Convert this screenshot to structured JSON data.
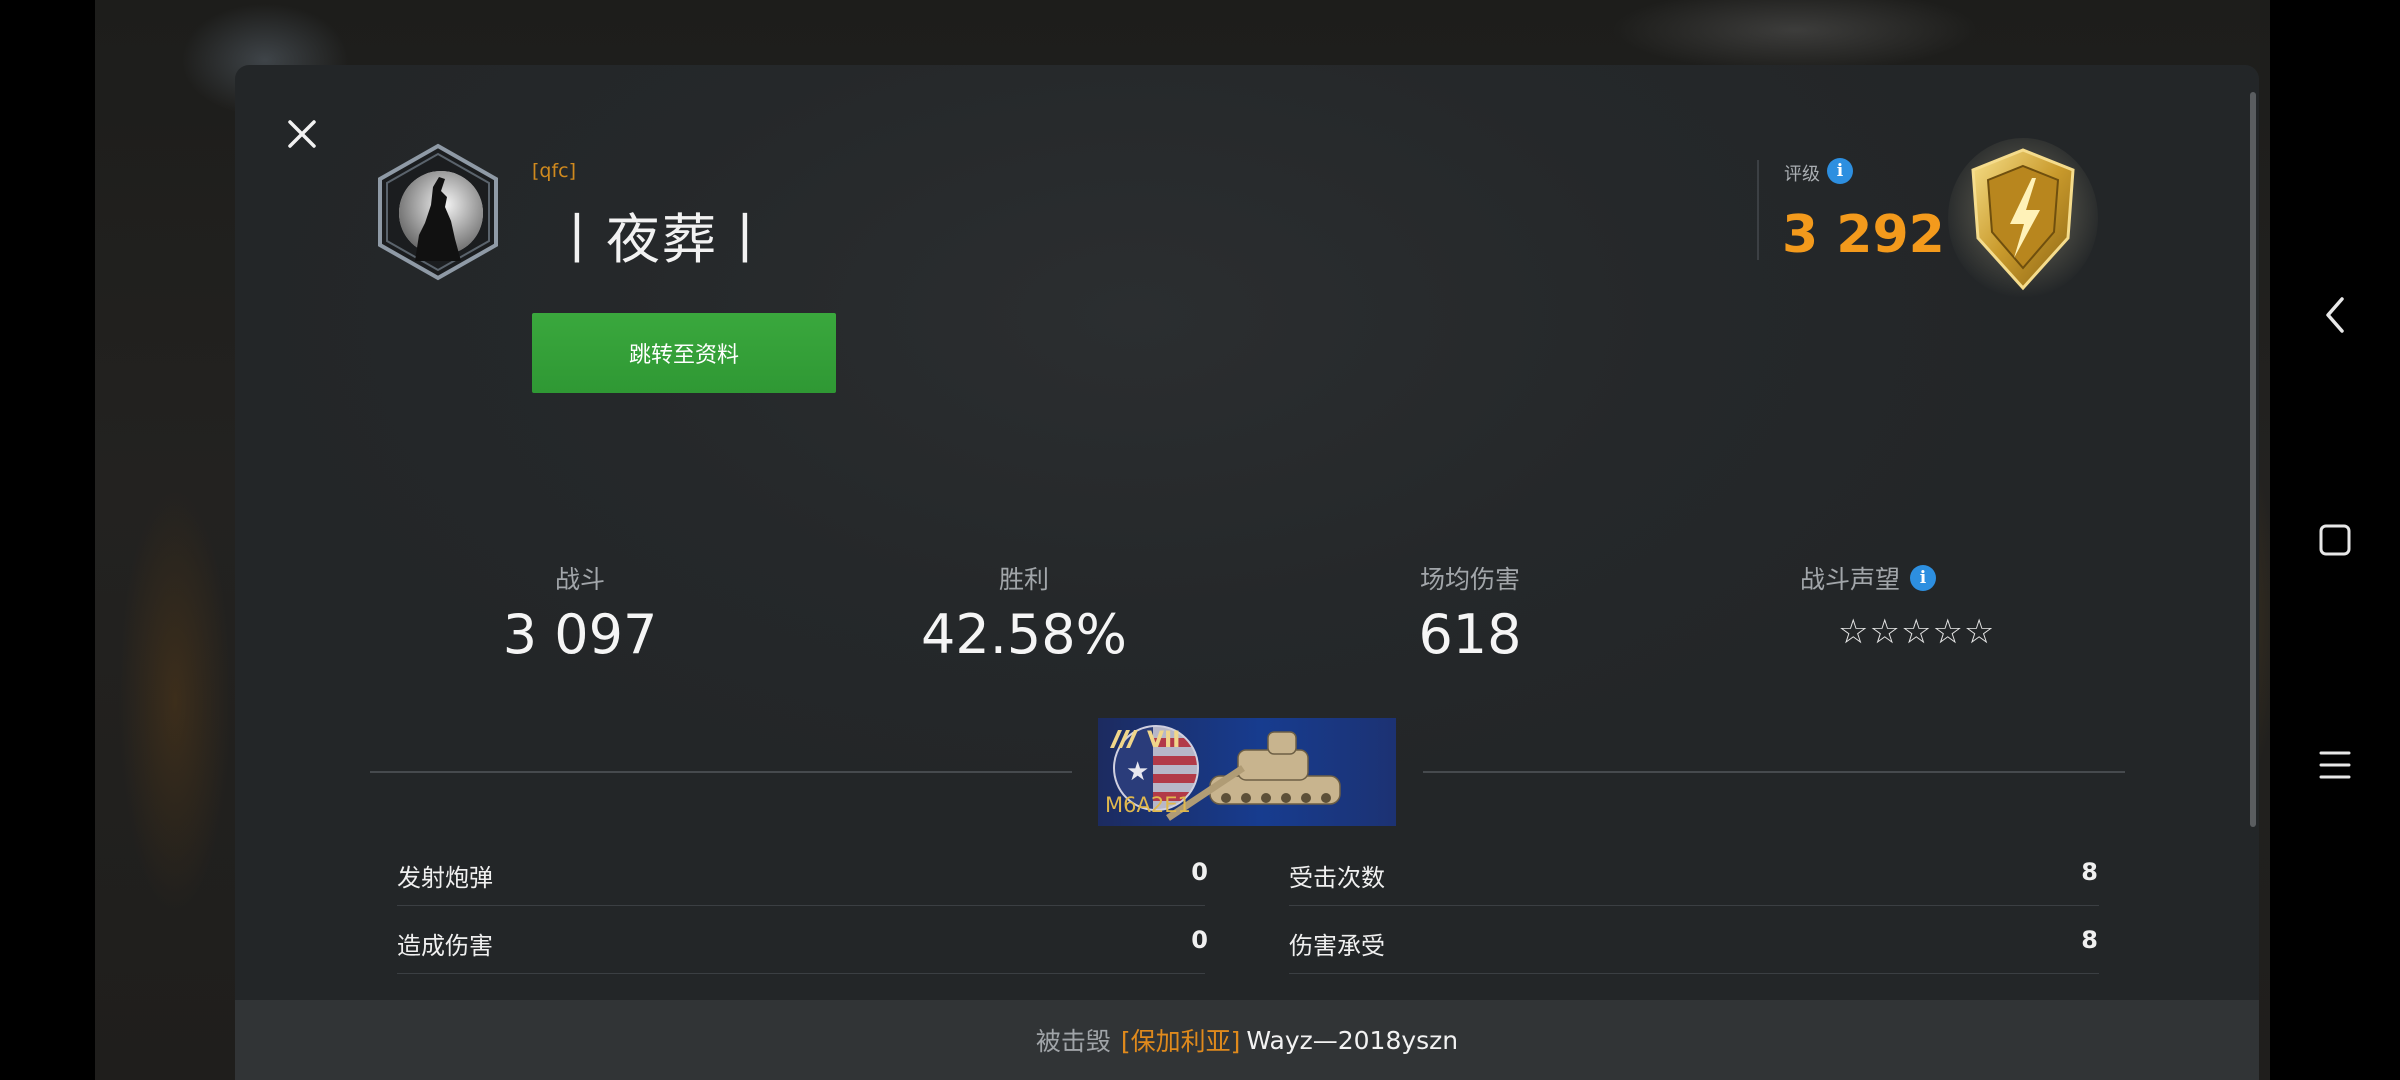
{
  "player": {
    "clan_tag": "[qfc]",
    "name": "丨夜葬丨",
    "profile_button_label": "跳转至资料"
  },
  "rating": {
    "label": "评级",
    "value": "3 292"
  },
  "stats": [
    {
      "label": "战斗",
      "value": "3 097"
    },
    {
      "label": "胜利",
      "value": "42.58%"
    },
    {
      "label": "场均伤害",
      "value": "618"
    },
    {
      "label": "战斗声望",
      "stars": "☆☆☆☆☆"
    }
  ],
  "tank": {
    "tier": "VII",
    "name": "M6A2E1"
  },
  "battle_rows": {
    "left": [
      {
        "label": "发射炮弹",
        "value": "0"
      },
      {
        "label": "造成伤害",
        "value": "0"
      }
    ],
    "right": [
      {
        "label": "受击次数",
        "value": "8"
      },
      {
        "label": "伤害承受",
        "value": "8"
      }
    ]
  },
  "footer": {
    "prefix": "被击毁",
    "clan": "[保加利亚]",
    "player": "Wayz—2018yszn"
  },
  "colors": {
    "accent_orange": "#f39a1c",
    "button_green": "#35a039",
    "info_blue": "#2d8fe0",
    "panel_bg": "#25282a"
  },
  "icons": {
    "close": "close-icon",
    "info": "info-icon",
    "back": "back-chevron-icon",
    "home": "home-square-icon",
    "menu": "menu-lines-icon"
  }
}
